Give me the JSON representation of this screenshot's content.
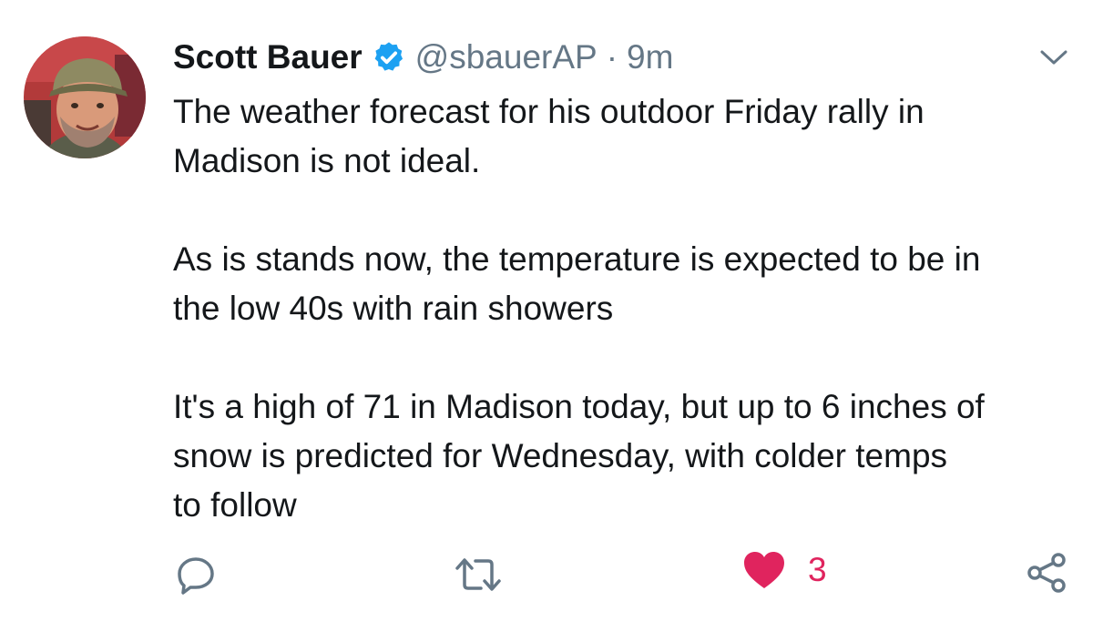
{
  "tweet": {
    "author": {
      "name": "Scott Bauer",
      "handle": "@sbauerAP",
      "separator": "·",
      "time": "9m",
      "verified": true,
      "avatar_icon": "profile-photo"
    },
    "paragraphs": [
      [
        "The weather forecast for his outdoor Friday rally in",
        "Madison is not ideal."
      ],
      [
        "As is stands now, the temperature is expected to be in",
        "the low 40s with rain showers"
      ],
      [
        "It's a high of 71 in Madison today, but up to 6 inches of",
        "snow is predicted for Wednesday, with colder temps",
        "to follow"
      ]
    ],
    "actions": {
      "reply_icon": "reply-icon",
      "retweet_icon": "retweet-icon",
      "like_icon": "heart-icon",
      "like_count": "3",
      "share_icon": "share-icon",
      "more_icon": "chevron-down-icon"
    }
  },
  "colors": {
    "text": "#14171a",
    "secondary": "#657786",
    "verified": "#1da1f2",
    "like": "#e0245e"
  }
}
